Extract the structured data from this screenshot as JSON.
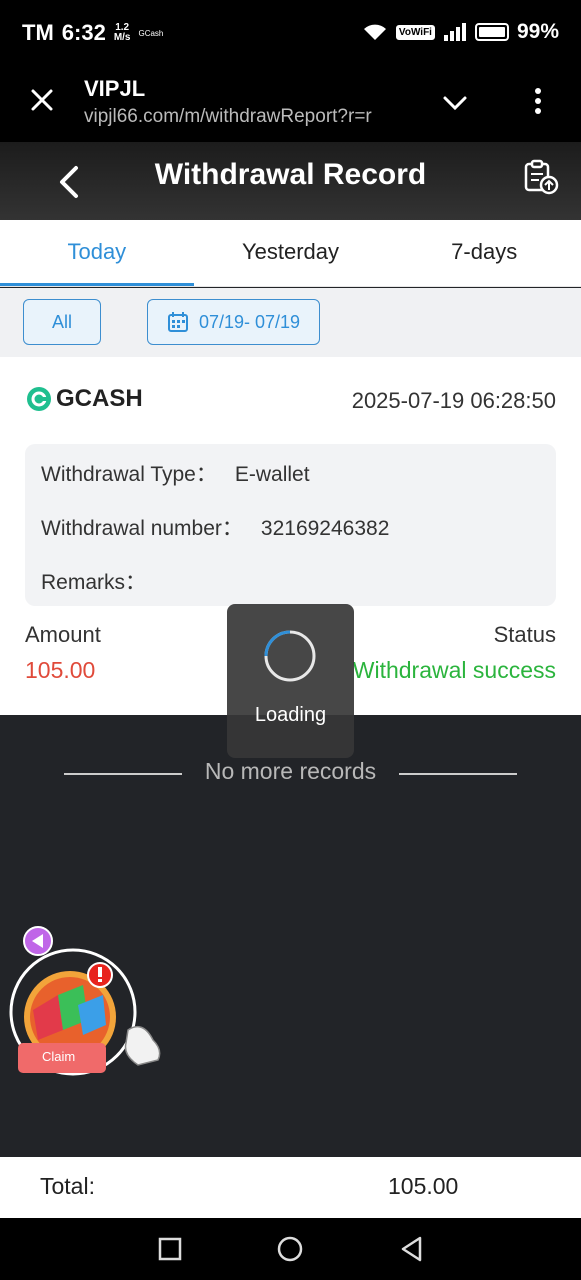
{
  "status_bar": {
    "carrier": "TM",
    "time": "6:32",
    "speed_value": "1.2",
    "speed_unit": "M/s",
    "app_indicator": "GCash",
    "vowifi": "VoWiFi",
    "battery": "99%"
  },
  "browser": {
    "title": "VIPJL",
    "url": "vipjl66.com/m/withdrawReport?r=r"
  },
  "header": {
    "title": "Withdrawal Record"
  },
  "tabs": [
    {
      "label": "Today",
      "active": true
    },
    {
      "label": "Yesterday",
      "active": false
    },
    {
      "label": "7-days",
      "active": false
    }
  ],
  "filters": {
    "type_label": "All",
    "date_range": "07/19- 07/19"
  },
  "record": {
    "provider": "GCASH",
    "datetime": "2025-07-19 06:28:50",
    "type_label": "Withdrawal Type：",
    "type_value": "E-wallet",
    "number_label": "Withdrawal number：",
    "number_value": "32169246382",
    "remarks_label": "Remarks：",
    "remarks_value": "",
    "amount_label": "Amount",
    "amount_value": "105.00",
    "status_label": "Status",
    "status_value": "Withdrawal success"
  },
  "list_end_text": "No more records",
  "loading_text": "Loading",
  "floating_widget": {
    "claim_label": "Claim"
  },
  "total": {
    "label": "Total:",
    "value": "105.00"
  },
  "colors": {
    "accent": "#2f8fd8",
    "amount": "#e04a3a",
    "success": "#2bb43d",
    "gcash": "#1fbf8f"
  }
}
